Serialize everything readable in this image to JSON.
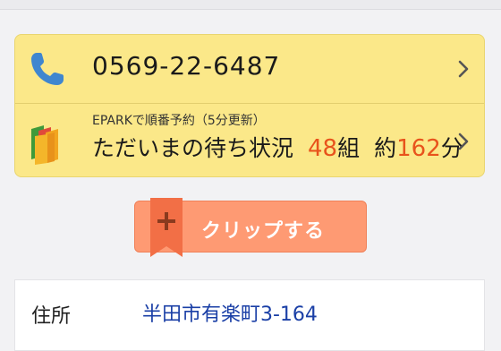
{
  "phone": {
    "number": "0569-22-6487",
    "icon": "phone-icon"
  },
  "wait_status": {
    "subtitle": "EPARKで順番予約（5分更新）",
    "label": "ただいまの待ち状況",
    "groups_value": "48",
    "groups_unit": "組",
    "approx_prefix": "約",
    "minutes_value": "162",
    "minutes_unit": "分",
    "icon": "epark-books-icon"
  },
  "clip_button": {
    "label": "クリップする",
    "icon": "plus-bookmark-icon"
  },
  "address": {
    "label": "住所",
    "value": "半田市有楽町3-164"
  },
  "colors": {
    "card_bg": "#fbe889",
    "accent_red": "#e8531c",
    "clip_button": "#fe9a73",
    "link_blue": "#1a3fa6"
  }
}
